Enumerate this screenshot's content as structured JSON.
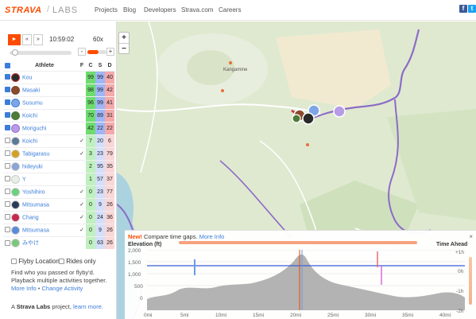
{
  "header": {
    "logo": "STRAVA",
    "sep": "/",
    "labs": "LABS",
    "nav": [
      "Projects",
      "Blog",
      "Developers",
      "Strava.com",
      "Careers"
    ],
    "social_icons": [
      "facebook-icon",
      "twitter-icon"
    ]
  },
  "controls": {
    "play": "►",
    "rewind": "«",
    "forward": "»",
    "time": "10:59:02",
    "speed": "60x",
    "decrease": "-",
    "increase": "+"
  },
  "table": {
    "headers": {
      "athlete": "Athlete",
      "f": "F",
      "c": "C",
      "s": "S",
      "d": "D"
    },
    "rows": [
      {
        "checked": true,
        "name": "Kou",
        "avatar": "#2a2a2a",
        "f": "",
        "c": "99",
        "s": "99",
        "d": "40",
        "color": "#c83232"
      },
      {
        "checked": true,
        "name": "Masaki",
        "avatar": "#8b4a2b",
        "f": "",
        "c": "98",
        "s": "99",
        "d": "42",
        "color": "#7a4a2b"
      },
      {
        "checked": true,
        "name": "Susumu",
        "avatar": "#7ea6e6",
        "f": "",
        "c": "96",
        "s": "99",
        "d": "41",
        "color": "#3b7dd8"
      },
      {
        "checked": true,
        "name": "Koichi",
        "avatar": "#4e7a3a",
        "f": "",
        "c": "70",
        "s": "89",
        "d": "31",
        "color": "#4e7a3a"
      },
      {
        "checked": true,
        "name": "Moriguchi",
        "avatar": "#b89be6",
        "f": "",
        "c": "42",
        "s": "22",
        "d": "22",
        "color": "#9b6bd8"
      },
      {
        "checked": false,
        "name": "Koichi",
        "avatar": "#5a7a9a",
        "f": "✓",
        "c": "7",
        "s": "20",
        "d": "6"
      },
      {
        "checked": false,
        "name": "Tabigarasu",
        "avatar": "#d4a020",
        "f": "✓",
        "c": "3",
        "s": "23",
        "d": "79"
      },
      {
        "checked": false,
        "name": "hideyuki",
        "avatar": "#8aa4d8",
        "f": "",
        "c": "2",
        "s": "95",
        "d": "35"
      },
      {
        "checked": false,
        "name": "Y",
        "avatar": "#e6f0e6",
        "f": "",
        "c": "1",
        "s": "57",
        "d": "37"
      },
      {
        "checked": false,
        "name": "Yoshihiro",
        "avatar": "#6ad27a",
        "f": "✓",
        "c": "0",
        "s": "23",
        "d": "77"
      },
      {
        "checked": false,
        "name": "Mitsumasa",
        "avatar": "#2a3a5a",
        "f": "✓",
        "c": "0",
        "s": "9",
        "d": "26"
      },
      {
        "checked": false,
        "name": "Chang",
        "avatar": "#c8284a",
        "f": "✓",
        "c": "0",
        "s": "24",
        "d": "36"
      },
      {
        "checked": false,
        "name": "Mitsumasa",
        "avatar": "#5a8ad8",
        "f": "✓",
        "c": "0",
        "s": "9",
        "d": "26"
      },
      {
        "checked": false,
        "name": "みやけ",
        "avatar": "#7ac87a",
        "f": "",
        "c": "0",
        "s": "63",
        "d": "26"
      }
    ]
  },
  "options": {
    "flyby_locations": "Flyby Locations",
    "rides_only": "Rides only"
  },
  "description": "Find who you passed or flyby'd. Playback multiple activities together.",
  "links": {
    "more_info": "More Info",
    "sep": "•",
    "change_activity": "Change Activity"
  },
  "footer": {
    "prefix": "A",
    "brand": "Strava Labs",
    "mid": "project,",
    "learn_more": "learn more."
  },
  "map": {
    "place_label": "Kangamine"
  },
  "elevation": {
    "notice_new": "New!",
    "notice_text": "Compare time gaps.",
    "notice_more": "More Info",
    "close": "×",
    "title": "Elevation (ft)",
    "time_ahead": "Time Ahead",
    "y_ticks": [
      "2,000",
      "1,500",
      "1,000",
      "500",
      "0"
    ],
    "x_ticks": [
      "0mi",
      "5mi",
      "10mi",
      "15mi",
      "20mi",
      "25mi",
      "30mi",
      "35mi",
      "40mi"
    ],
    "right_ticks": [
      "+1h",
      "0h",
      "-1h",
      "-2h"
    ]
  }
}
